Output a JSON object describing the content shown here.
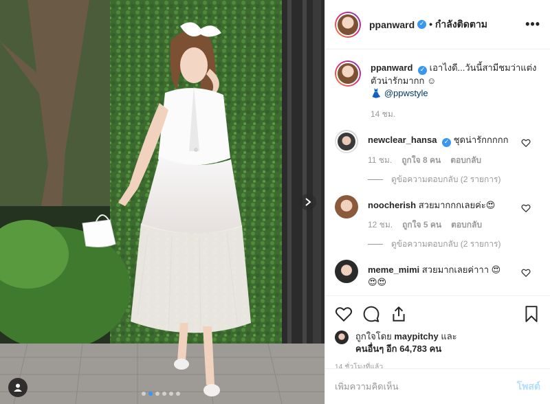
{
  "post": {
    "author": "ppanward",
    "follow_status": "• กำลังติดตาม",
    "more_icon": "more-dots-icon",
    "photo_description_icon": "carousel-photo",
    "carousel": {
      "count": 6,
      "active_index": 1
    }
  },
  "caption": {
    "username": "ppanward",
    "line1": "เอาไงดี...วันนี้สามีชมว่าแต่ง",
    "line2": "ตัวน่ารักมากก ☺",
    "dress_emoji": "👗",
    "mention": "@ppwstyle",
    "time": "14 ชม."
  },
  "comments": [
    {
      "username": "newclear_hansa",
      "verified": true,
      "text": "ชุดน่ารักกกกก",
      "time": "11 ชม.",
      "likes": "ถูกใจ 8 คน",
      "reply_label": "ตอบกลับ",
      "view_replies": "ดูข้อความตอบกลับ (2 รายการ)"
    },
    {
      "username": "noocherish",
      "verified": false,
      "text": "สวยมากกกเลยค่ะ😍",
      "time": "12 ชม.",
      "likes": "ถูกใจ 5 คน",
      "reply_label": "ตอบกลับ",
      "view_replies": "ดูข้อความตอบกลับ (2 รายการ)"
    },
    {
      "username": "meme_mimi",
      "verified": false,
      "text": "สวยมากเลยค่าาา 😍",
      "text2": "😍😍"
    }
  ],
  "liked_by": {
    "prefix": "ถูกใจโดย",
    "user": "maypitchy",
    "conj": "และ",
    "others_prefix": "คนอื่นๆ อีก",
    "count": "64,783",
    "suffix": "คน"
  },
  "timestamp": "14 ชั่วโมงที่แล้ว",
  "add_comment": {
    "placeholder": "เพิ่มความคิดเห็น",
    "post_label": "โพสต์"
  },
  "colors": {
    "accent": "#3897f0",
    "post_disabled": "#b2dffc",
    "muted": "#999999"
  }
}
